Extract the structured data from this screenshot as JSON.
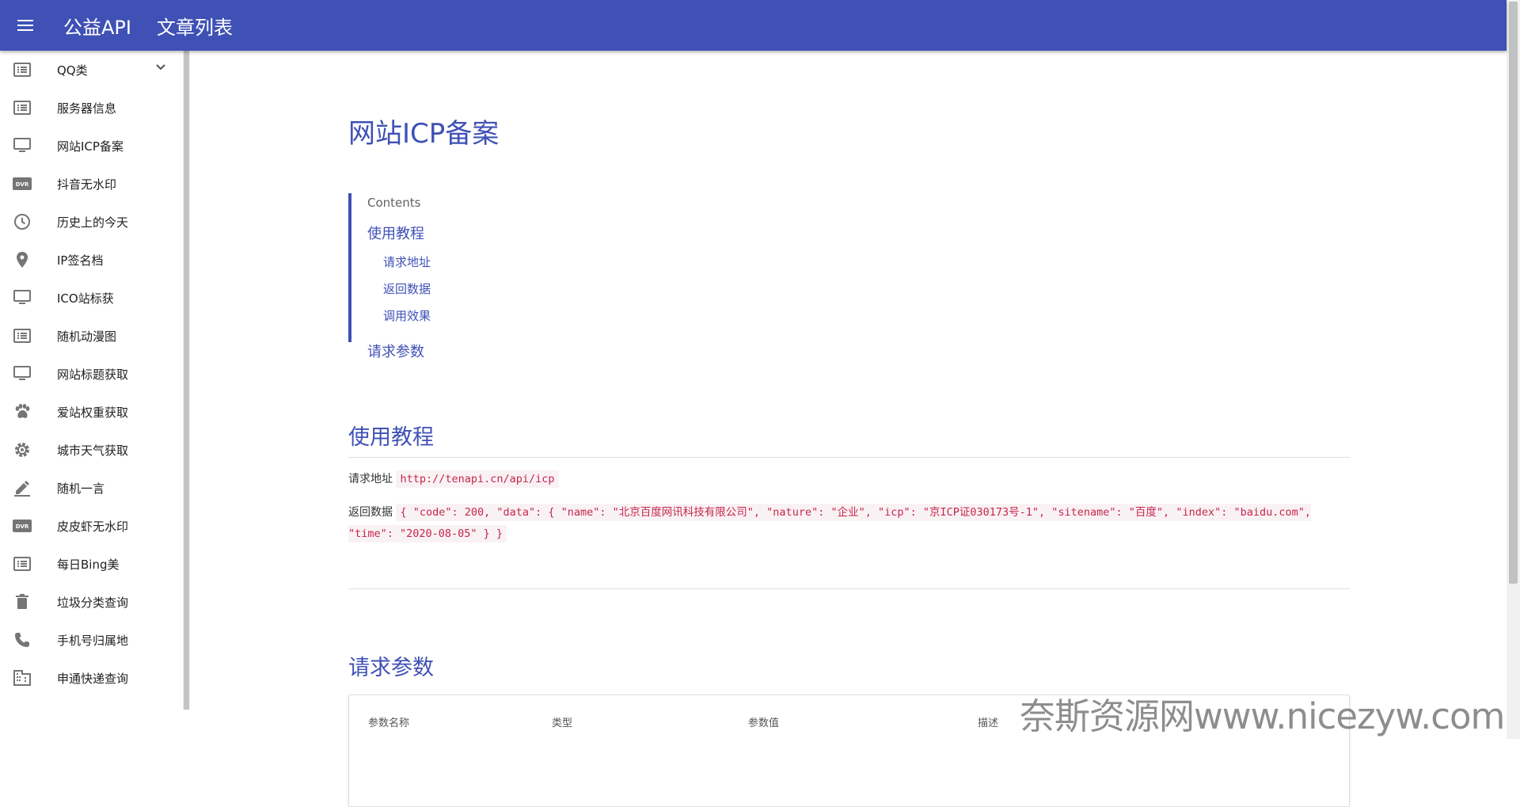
{
  "header": {
    "brand": "公益API",
    "subtitle": "文章列表"
  },
  "sidebar": {
    "items": [
      {
        "label": "QQ类",
        "icon": "list-icon",
        "expandable": true
      },
      {
        "label": "服务器信息",
        "icon": "list-icon"
      },
      {
        "label": "网站ICP备案",
        "icon": "monitor-icon"
      },
      {
        "label": "抖音无水印",
        "icon": "dvr-icon"
      },
      {
        "label": "历史上的今天",
        "icon": "clock-icon"
      },
      {
        "label": "IP签名档",
        "icon": "location-pin-icon"
      },
      {
        "label": "ICO站标获",
        "icon": "monitor-icon"
      },
      {
        "label": "随机动漫图",
        "icon": "list-icon"
      },
      {
        "label": "网站标题获取",
        "icon": "monitor-icon"
      },
      {
        "label": "爱站权重获取",
        "icon": "paw-icon"
      },
      {
        "label": "城市天气获取",
        "icon": "gear-icon"
      },
      {
        "label": "随机一言",
        "icon": "pencil-icon"
      },
      {
        "label": "皮皮虾无水印",
        "icon": "dvr-icon"
      },
      {
        "label": "每日Bing美",
        "icon": "list-icon"
      },
      {
        "label": "垃圾分类查询",
        "icon": "trash-icon"
      },
      {
        "label": "手机号归属地",
        "icon": "phone-icon"
      },
      {
        "label": "申通快递查询",
        "icon": "building-icon"
      }
    ]
  },
  "main": {
    "title": "网站ICP备案",
    "toc": {
      "caption": "Contents",
      "section1": "使用教程",
      "sub1": "请求地址",
      "sub2": "返回数据",
      "sub3": "调用效果",
      "section2": "请求参数"
    },
    "section1": {
      "heading": "使用教程",
      "request_label": "请求地址",
      "request_url": "http://tenapi.cn/api/icp",
      "response_label": "返回数据",
      "response_json": "{ \"code\": 200, \"data\": { \"name\": \"北京百度网讯科技有限公司\", \"nature\": \"企业\", \"icp\": \"京ICP证030173号-1\", \"sitename\": \"百度\", \"index\": \"baidu.com\", \"time\": \"2020-08-05\" } }"
    },
    "section2": {
      "heading": "请求参数",
      "columns": [
        "参数名称",
        "类型",
        "参数值",
        "描述"
      ]
    }
  },
  "watermark": "奈斯资源网www.nicezyw.com",
  "colors": {
    "primary": "#3f51b5",
    "code_text": "#c7254e",
    "code_bg": "#f9f2f4"
  }
}
